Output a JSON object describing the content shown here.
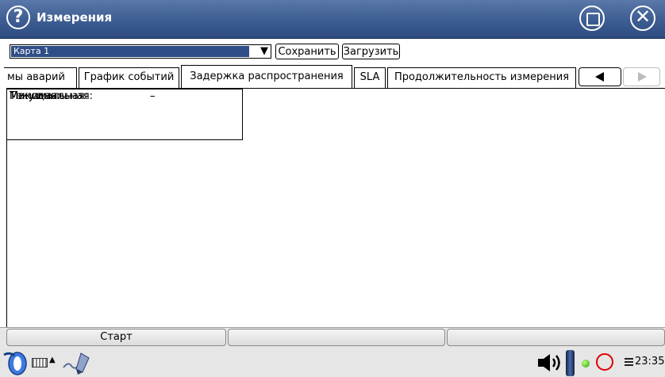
{
  "window": {
    "title": "Измерения"
  },
  "toolbar": {
    "card_value": "Карта 1",
    "save_label": "Сохранить",
    "load_label": "Загрузить"
  },
  "tabs": [
    {
      "label": "мы аварий",
      "active": false
    },
    {
      "label": "График событий",
      "active": false
    },
    {
      "label": "Задержка распространения",
      "active": true
    },
    {
      "label": "SLA",
      "active": false
    },
    {
      "label": "Продолжительность измерения",
      "active": false
    }
  ],
  "measurements": [
    {
      "label": "Текущая:",
      "value": "–"
    },
    {
      "label": "Минимальная:",
      "value": "–"
    },
    {
      "label": "Максимальная:",
      "value": "–"
    }
  ],
  "bottom": {
    "start_label": "Старт"
  },
  "taskbar": {
    "time": "23:35"
  },
  "colors": {
    "titlebar": "#3f5f94",
    "select_highlight": "#2f4d86",
    "record": "#e00000",
    "led": "#2ea000"
  }
}
